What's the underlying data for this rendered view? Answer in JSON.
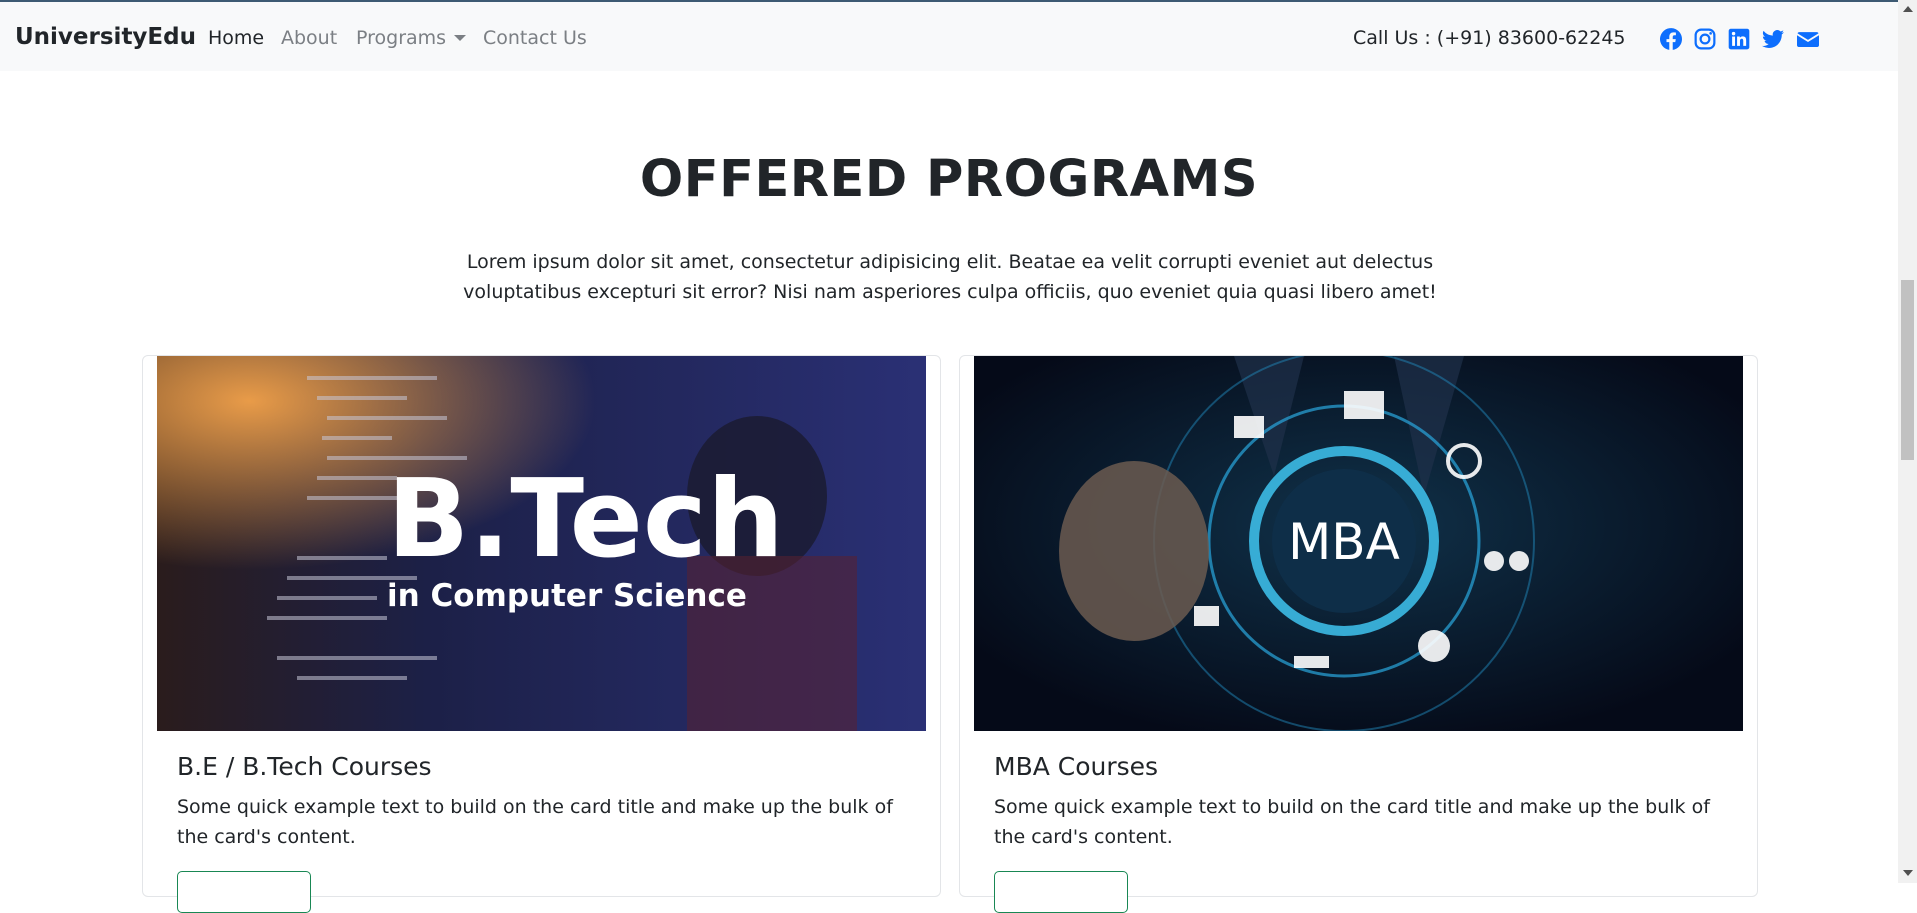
{
  "navbar": {
    "brand": "UniversityEdu",
    "links": [
      {
        "label": "Home"
      },
      {
        "label": "About"
      },
      {
        "label": "Programs"
      },
      {
        "label": "Contact Us"
      }
    ],
    "phone": "Call Us : (+91) 83600-62245",
    "social_icons": [
      "facebook-icon",
      "instagram-icon",
      "linkedin-icon",
      "twitter-icon",
      "envelope-icon"
    ],
    "social_color": "#0d6efd"
  },
  "section": {
    "title": "OFFERED PROGRAMS",
    "description": "Lorem ipsum dolor sit amet, consectetur adipisicing elit. Beatae ea velit corrupti eveniet aut delectus voluptatibus excepturi sit error? Nisi nam asperiores culpa officiis, quo eveniet quia quasi libero amet!"
  },
  "cards": [
    {
      "title": "B.E / B.Tech Courses",
      "text": "Some quick example text to build on the card title and make up the bulk of the card's content.",
      "image_text_main": "B.Tech",
      "image_text_sub": "in Computer Science"
    },
    {
      "title": "MBA Courses",
      "text": "Some quick example text to build on the card title and make up the bulk of the card's content.",
      "image_text_main": "MBA"
    }
  ]
}
